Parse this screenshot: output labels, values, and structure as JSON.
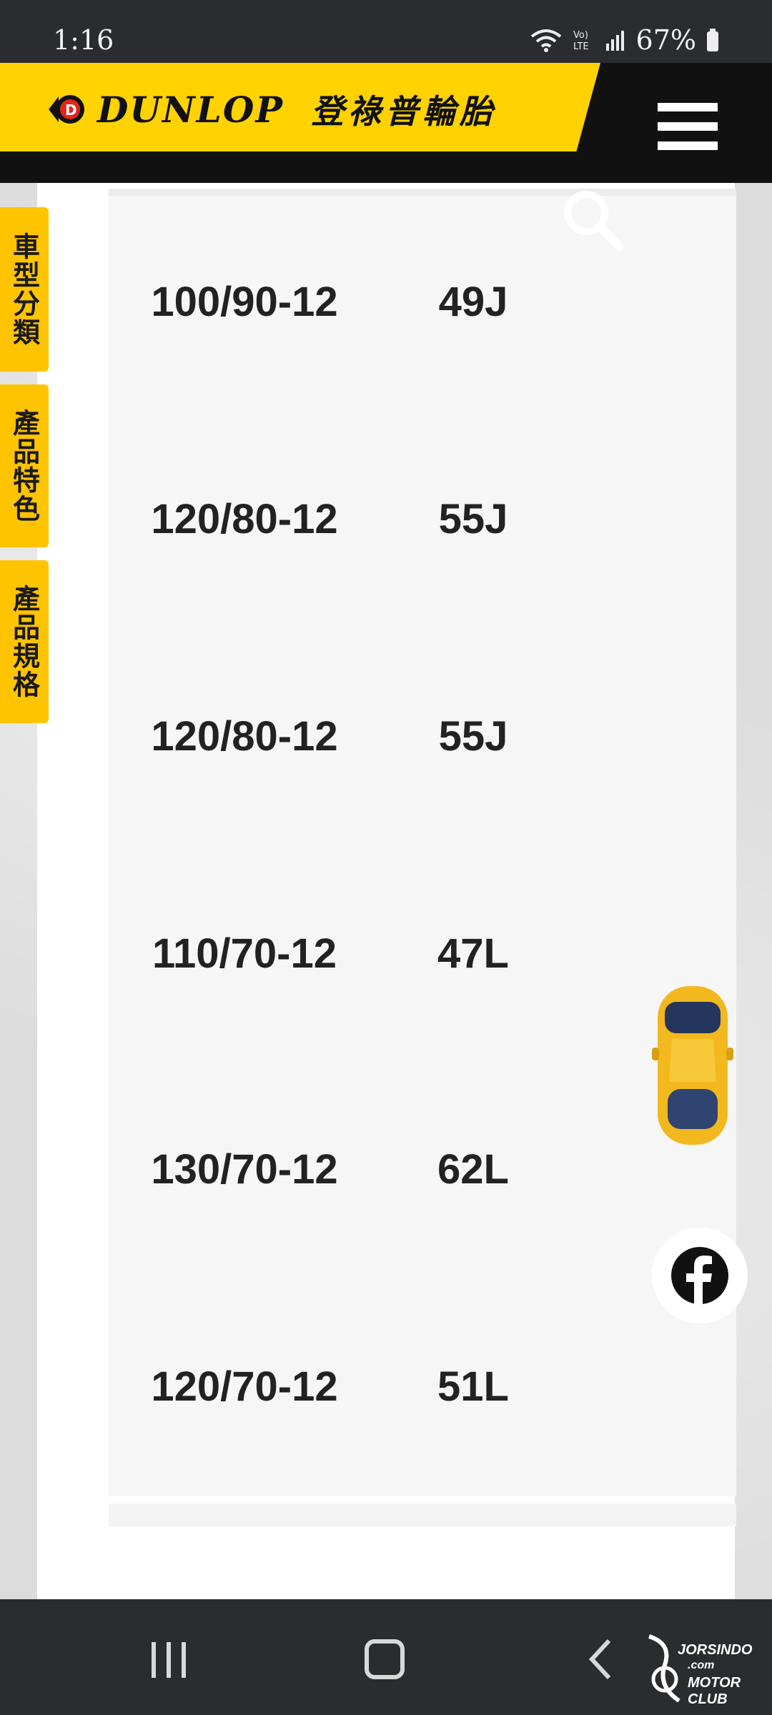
{
  "status_bar": {
    "time": "1:16",
    "battery": "67%",
    "icons": [
      "wifi-icon",
      "volte-icon",
      "signal-icon",
      "battery-icon"
    ]
  },
  "header": {
    "brand": "DUNLOP",
    "brand_cn": "登祿普輪胎",
    "accent_color": "#ffd200",
    "menu_icon": "hamburger-icon"
  },
  "side_tabs": [
    {
      "label": "車型分類"
    },
    {
      "label": "產品特色"
    },
    {
      "label": "產品規格"
    }
  ],
  "spec_table": {
    "rows": [
      {
        "size": "100/90-12",
        "index": "49J"
      },
      {
        "size": "120/80-12",
        "index": "55J"
      },
      {
        "size": "120/80-12",
        "index": "55J"
      },
      {
        "size": "110/70-12",
        "index": "47L"
      },
      {
        "size": "130/70-12",
        "index": "62L"
      },
      {
        "size": "120/70-12",
        "index": "51L"
      }
    ]
  },
  "floating": {
    "search_icon": "search-icon",
    "car_icon": "car-icon",
    "facebook_icon": "facebook-icon"
  },
  "watermark": {
    "line1": "JORSINDO",
    "line2": ".com",
    "line3": "MOTOR CLUB"
  }
}
